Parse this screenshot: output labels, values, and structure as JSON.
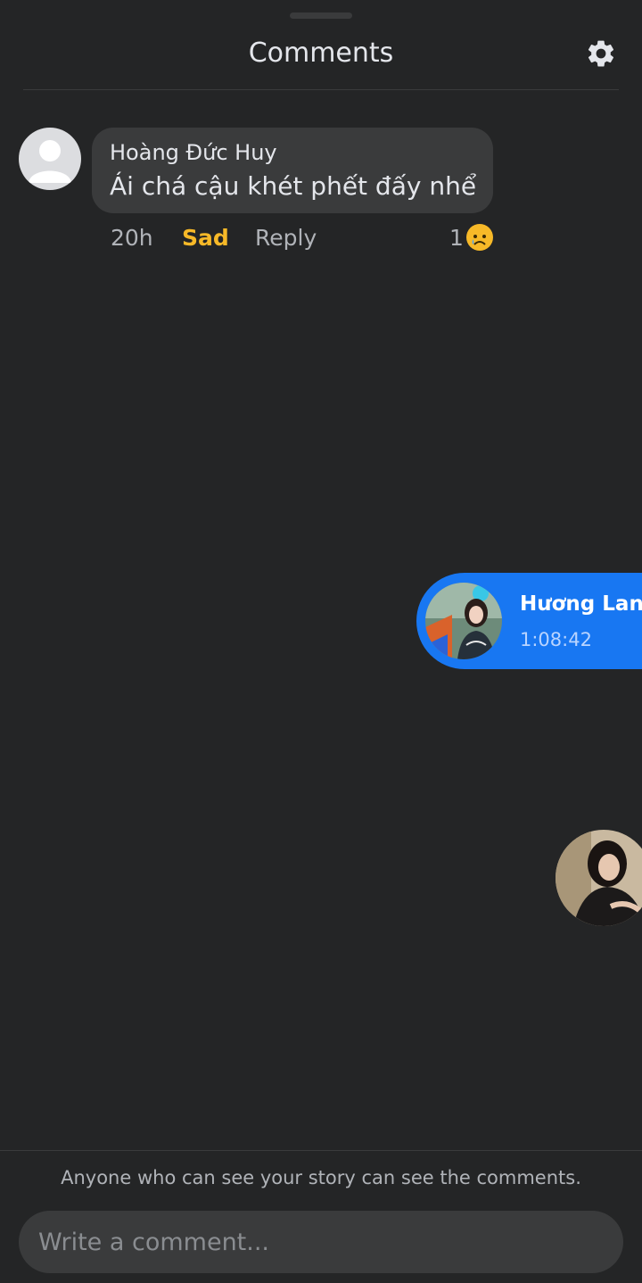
{
  "header": {
    "title": "Comments",
    "settings_icon": "gear-icon"
  },
  "comment": {
    "author": "Hoàng Đức Huy",
    "text": "Ái chá cậu khét phết đấy nhể",
    "time": "20h",
    "reaction_label": "Sad",
    "reply_label": "Reply",
    "reaction_count": "1",
    "reaction_icon": "sad-emoji-icon"
  },
  "chat_head": {
    "name": "Hương Lan",
    "time": "1:08:42"
  },
  "footer": {
    "note": "Anyone who can see your story can see the comments.",
    "input_placeholder": "Write a comment..."
  },
  "colors": {
    "background": "#242526",
    "bubble": "#3a3b3c",
    "accent_blue": "#1877f2",
    "sad_reaction": "#f7b928"
  }
}
